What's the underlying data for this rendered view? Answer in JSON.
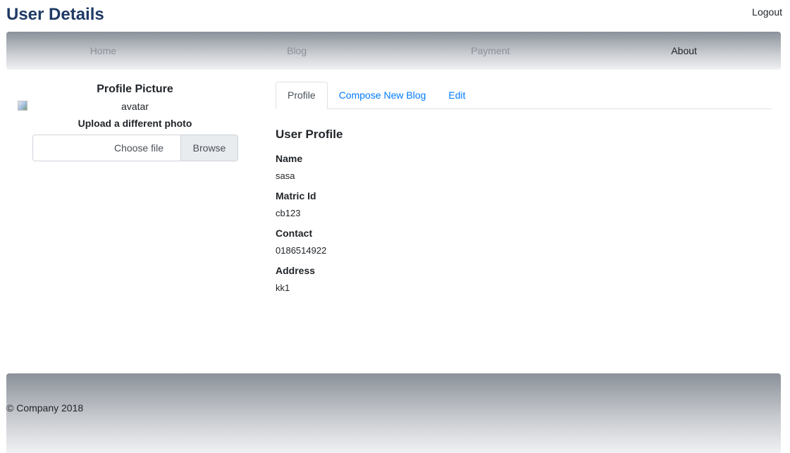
{
  "header": {
    "title": "User Details",
    "logout_label": "Logout"
  },
  "nav": {
    "items": [
      {
        "label": "Home"
      },
      {
        "label": "Blog"
      },
      {
        "label": "Payment"
      },
      {
        "label": "About"
      }
    ]
  },
  "sidebar": {
    "title": "Profile Picture",
    "avatar_alt": "avatar",
    "upload_label": "Upload a different photo",
    "file_placeholder": "Choose file",
    "browse_label": "Browse"
  },
  "tabs": [
    {
      "label": "Profile"
    },
    {
      "label": "Compose New Blog"
    },
    {
      "label": "Edit"
    }
  ],
  "profile": {
    "title": "User Profile",
    "fields": [
      {
        "label": "Name",
        "value": "sasa"
      },
      {
        "label": "Matric Id",
        "value": "cb123"
      },
      {
        "label": "Contact",
        "value": "0186514922"
      },
      {
        "label": "Address",
        "value": "kk1"
      }
    ]
  },
  "footer": {
    "text": "© Company 2018"
  },
  "colors": {
    "title": "#1f3a66",
    "link": "#007bff",
    "nav_inactive": "#8a9098"
  }
}
